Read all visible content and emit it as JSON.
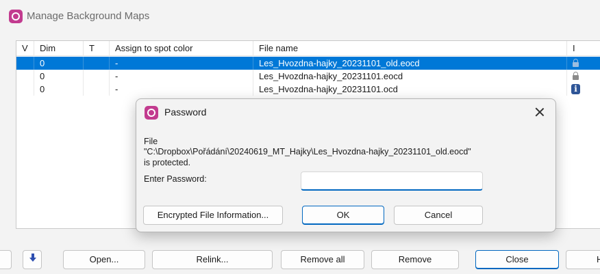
{
  "window": {
    "title": "Manage Background Maps"
  },
  "table": {
    "columns": [
      "V",
      "Dim",
      "T",
      "Assign to spot color",
      "File name",
      "I"
    ],
    "rows": [
      {
        "v": "",
        "dim": "0",
        "t": "",
        "spot": "-",
        "file": "Les_Hvozdna-hajky_20231101_old.eocd",
        "icon": "lock-icon",
        "selected": true
      },
      {
        "v": "",
        "dim": "0",
        "t": "",
        "spot": "-",
        "file": "Les_Hvozdna-hajky_20231101.eocd",
        "icon": "lock-icon",
        "selected": false
      },
      {
        "v": "",
        "dim": "0",
        "t": "",
        "spot": "-",
        "file": "Les_Hvozdna-hajky_20231101.ocd",
        "icon": "info-icon",
        "selected": false
      }
    ]
  },
  "buttons": {
    "move_down_icon": "arrow-down-icon",
    "open": "Open...",
    "relink": "Relink...",
    "remove_all": "Remove all",
    "remove": "Remove",
    "close": "Close",
    "help_partial": "H"
  },
  "dialog": {
    "title": "Password",
    "file_label": "File",
    "file_path": "\"C:\\Dropbox\\Pořádání\\20240619_MT_Hajky\\Les_Hvozdna-hajky_20231101_old.eocd\"",
    "protected_text": "is protected.",
    "enter_password_label": "Enter Password:",
    "password_value": "",
    "buttons": {
      "encrypted_info": "Encrypted File Information...",
      "ok": "OK",
      "cancel": "Cancel"
    }
  },
  "colors": {
    "accent": "#0078d7",
    "app_icon": "#c23b8f",
    "info_icon": "#2e5597",
    "arrow_icon": "#2d4fb0"
  }
}
